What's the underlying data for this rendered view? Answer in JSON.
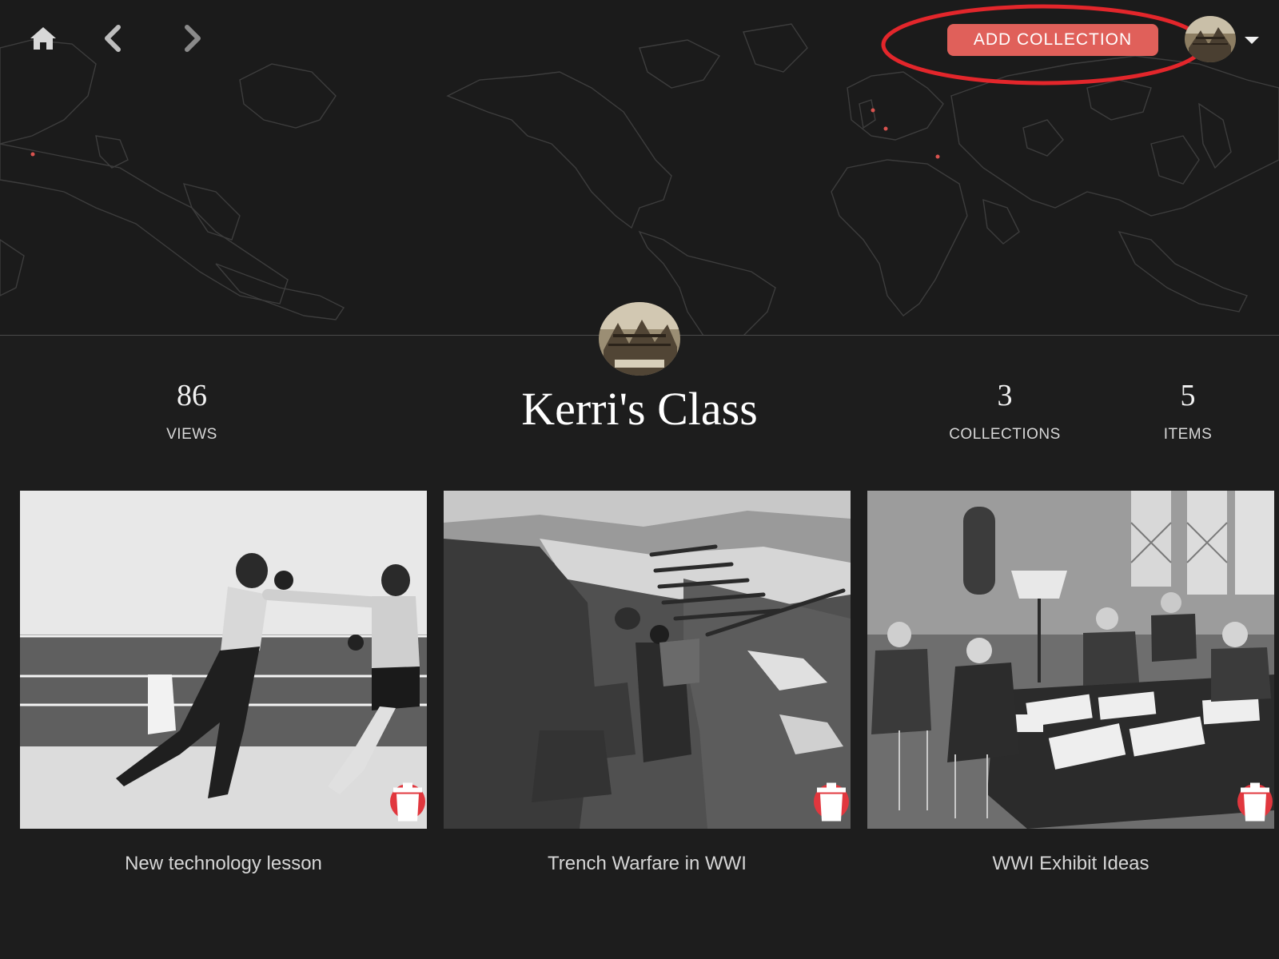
{
  "header": {
    "add_collection_label": "ADD COLLECTION"
  },
  "icons": {
    "home": "home-icon",
    "back": "chevron-left-icon",
    "forward": "chevron-right-icon",
    "menu": "caret-down-icon",
    "delete": "trash-icon"
  },
  "colors": {
    "background": "#1d1d1d",
    "accent": "#e0605a",
    "delete": "#e1373e",
    "highlight_ring": "#e3262b"
  },
  "profile": {
    "title": "Kerri's Class",
    "stats": {
      "views": {
        "value": "86",
        "label": "VIEWS"
      },
      "collections": {
        "value": "3",
        "label": "COLLECTIONS"
      },
      "items": {
        "value": "5",
        "label": "ITEMS"
      }
    }
  },
  "collections": [
    {
      "title": "New technology lesson"
    },
    {
      "title": "Trench Warfare in WWI"
    },
    {
      "title": "WWI Exhibit Ideas"
    }
  ]
}
